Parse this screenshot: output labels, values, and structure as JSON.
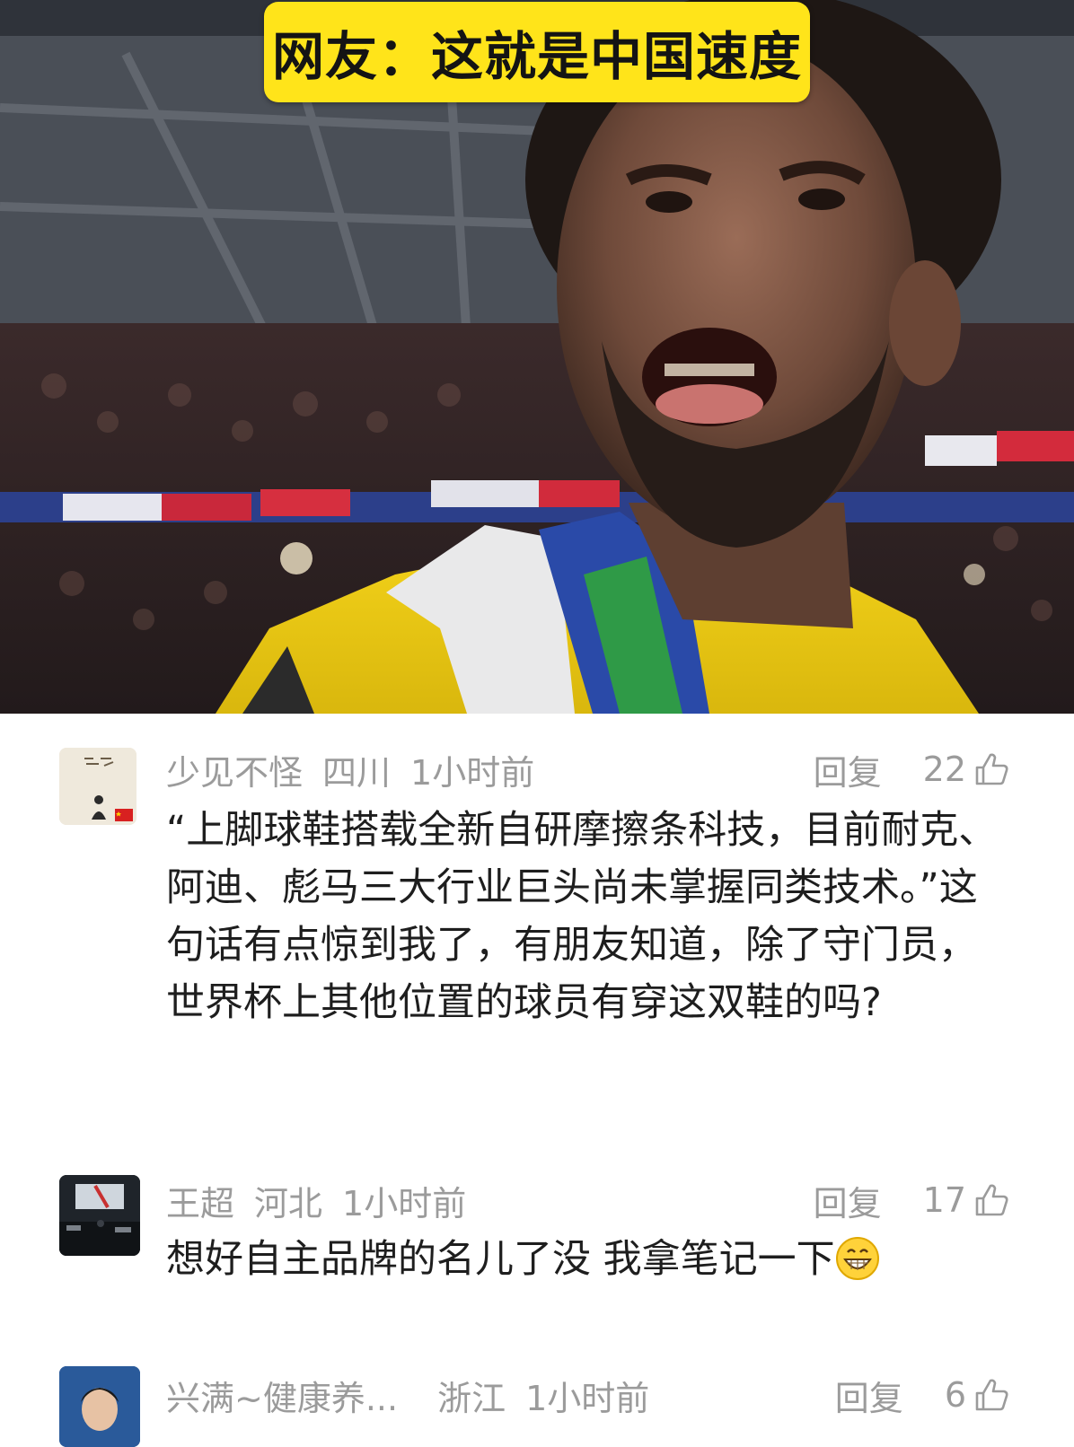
{
  "hero": {
    "caption": "网友：这就是中国速度",
    "image": "soccer-player-celebrating-photo",
    "badge_color": "#ffe41a"
  },
  "comments": [
    {
      "avatar": "avatar-calligraphy-figure",
      "name": "少见不怪",
      "region": "四川",
      "time": "1小时前",
      "reply_label": "回复",
      "likes": "22",
      "text": "“上脚球鞋搭载全新自研摩擦条科技，目前耐克、阿迪、彪马三大行业巨头尚未掌握同类技术。”这句话有点惊到我了，有朋友知道，除了守门员，世界杯上其他位置的球员有穿这双鞋的吗?"
    },
    {
      "avatar": "avatar-dark-street-scene",
      "name": "王超",
      "region": "河北",
      "time": "1小时前",
      "reply_label": "回复",
      "likes": "17",
      "text": "想好自主品牌的名儿了没 我拿笔记一下",
      "emoji": "grinning-face-emoji"
    },
    {
      "avatar": "avatar-man-portrait",
      "name": "兴满~健康养...",
      "region": "浙江",
      "time": "1小时前",
      "reply_label": "回复",
      "likes": "6"
    }
  ],
  "colors": {
    "meta_text": "#9b9b9b",
    "body_text": "#1e1e1e",
    "background": "#ffffff"
  }
}
